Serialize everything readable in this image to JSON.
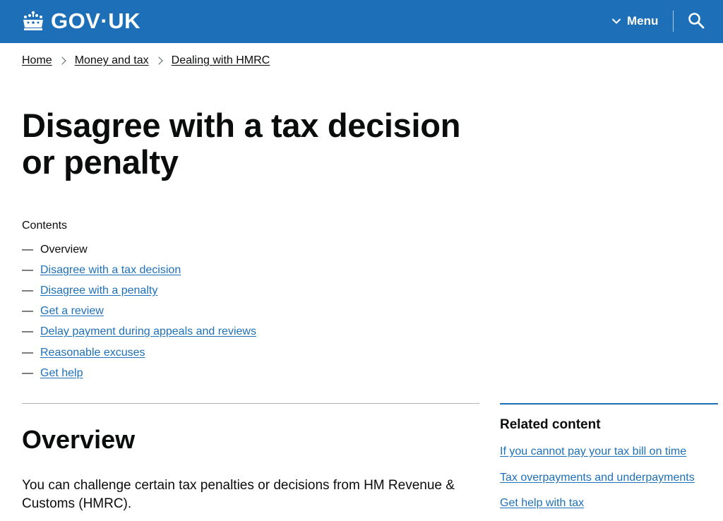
{
  "header": {
    "logo_text": "GOV·UK",
    "menu_label": "Menu"
  },
  "breadcrumb": [
    "Home",
    "Money and tax",
    "Dealing with HMRC"
  ],
  "page_title": "Disagree with a tax decision or penalty",
  "contents": {
    "label": "Contents",
    "items": [
      {
        "label": "Overview",
        "current": true
      },
      {
        "label": "Disagree with a tax decision",
        "current": false
      },
      {
        "label": "Disagree with a penalty",
        "current": false
      },
      {
        "label": "Get a review",
        "current": false
      },
      {
        "label": "Delay payment during appeals and reviews",
        "current": false
      },
      {
        "label": "Reasonable excuses",
        "current": false
      },
      {
        "label": "Get help",
        "current": false
      }
    ]
  },
  "overview": {
    "heading": "Overview",
    "intro": "You can challenge certain tax penalties or decisions from HM Revenue & Customs (HMRC)."
  },
  "related": {
    "heading": "Related content",
    "links": [
      "If you cannot pay your tax bill on time",
      "Tax overpayments and underpayments",
      "Get help with tax"
    ]
  },
  "colors": {
    "brand_blue": "#1d70b8",
    "text": "#0b0c0c",
    "rule": "#b1b4b6"
  },
  "icons": [
    "crown-icon",
    "chevron-down-icon",
    "search-icon",
    "chevron-right-icon"
  ]
}
